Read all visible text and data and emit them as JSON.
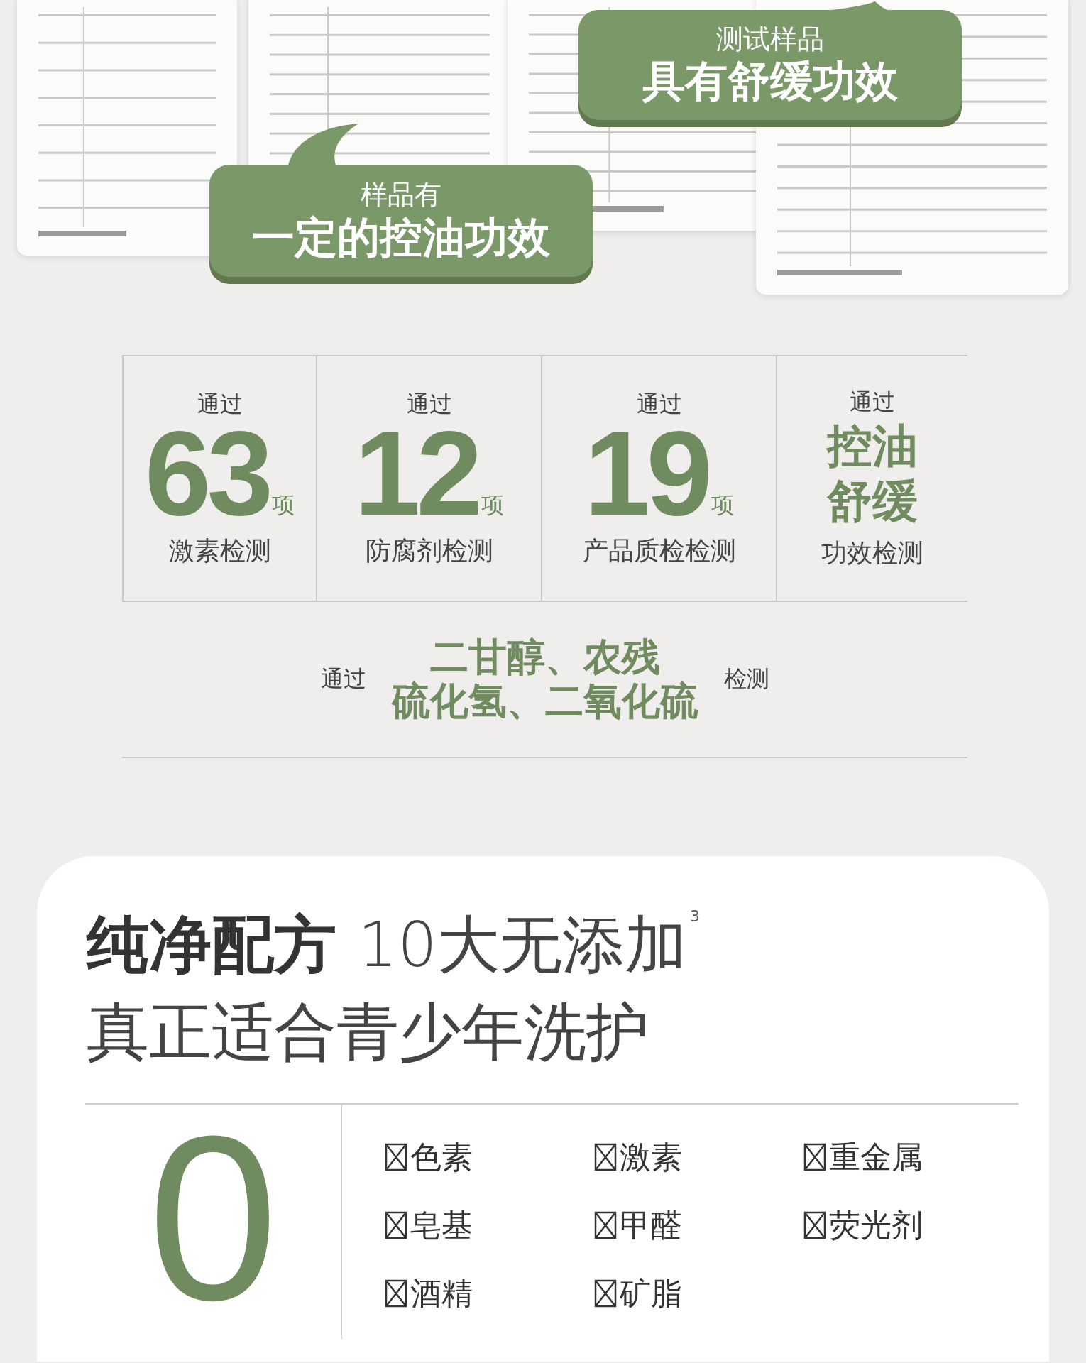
{
  "callouts": [
    {
      "caption": "样品有",
      "headline": "一定的控油功效",
      "kind": "tail_left"
    },
    {
      "caption": "测试样品",
      "headline": "具有舒缓功效",
      "kind": "tail_right"
    }
  ],
  "stats": [
    {
      "kind": "number",
      "prefix": "通过",
      "value": "63",
      "unit": "项",
      "label": "激素检测"
    },
    {
      "kind": "number",
      "prefix": "通过",
      "value": "12",
      "unit": "项",
      "label": "防腐剂检测"
    },
    {
      "kind": "number",
      "prefix": "通过",
      "value": "19",
      "unit": "项",
      "label": "产品质检检测"
    },
    {
      "kind": "words",
      "prefix": "通过",
      "words": [
        "控油",
        "舒缓"
      ],
      "label": "功效检测"
    }
  ],
  "also_passed": {
    "prefix": "通过",
    "items": [
      "二甘醇、农残",
      "硫化氢、二氧化硫"
    ],
    "suffix": "检测"
  },
  "formula": {
    "title": "纯净配方",
    "subtitle": "10大无添加",
    "note": "3",
    "tagline": "真正适合青少年洗护",
    "count": "0",
    "free_of": [
      "色素",
      "激素",
      "重金属",
      "皂基",
      "甲醛",
      "荧光剂",
      "酒精",
      "矿脂"
    ]
  }
}
